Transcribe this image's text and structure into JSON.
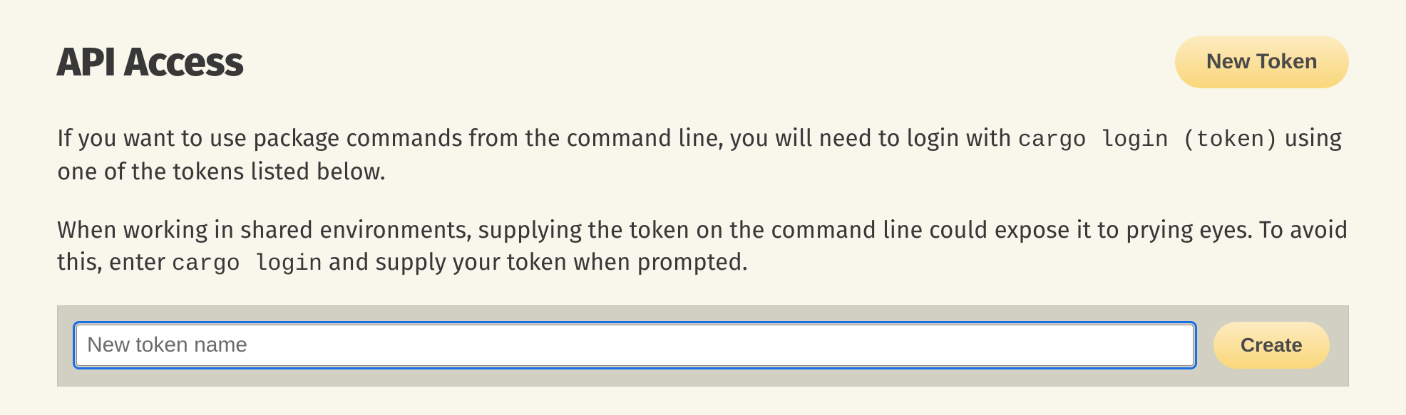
{
  "header": {
    "title": "API Access",
    "new_token_label": "New Token"
  },
  "description": {
    "p1_a": "If you want to use package commands from the command line, you will need to login with ",
    "p1_code": "cargo login (token)",
    "p1_b": " using one of the tokens listed below.",
    "p2_a": "When working in shared environments, supplying the token on the command line could expose it to prying eyes. To avoid this, enter ",
    "p2_code": "cargo login",
    "p2_b": " and supply your token when prompted."
  },
  "form": {
    "name_placeholder": "New token name",
    "name_value": "",
    "create_label": "Create"
  }
}
